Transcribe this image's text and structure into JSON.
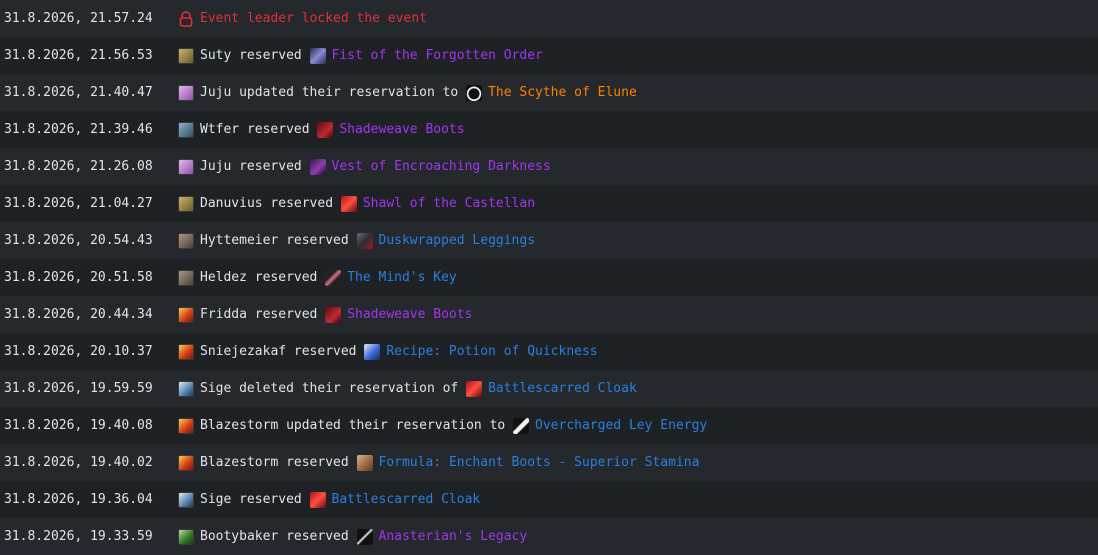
{
  "events": [
    {
      "time": "31.8.2026, 21.57.24",
      "type": "lock",
      "message": "Event leader locked the event",
      "icon": "lock-icon",
      "color": "#e0313b"
    },
    {
      "time": "31.8.2026, 21.56.53",
      "user": "Suty",
      "user_icon": "class-icon-rogue",
      "action": "reserved",
      "item": "Fist of the Forgotten Order",
      "item_icon": "weapon-icon",
      "quality": "epic"
    },
    {
      "time": "31.8.2026, 21.40.47",
      "user": "Juju",
      "user_icon": "class-icon-druid",
      "action": "updated their reservation to",
      "item": "The Scythe of Elune",
      "item_icon": "scythe-icon",
      "quality": "legendary"
    },
    {
      "time": "31.8.2026, 21.39.46",
      "user": "Wtfer",
      "user_icon": "class-icon-shaman",
      "action": "reserved",
      "item": "Shadeweave Boots",
      "item_icon": "boots-icon",
      "quality": "epic"
    },
    {
      "time": "31.8.2026, 21.26.08",
      "user": "Juju",
      "user_icon": "class-icon-druid",
      "action": "reserved",
      "item": "Vest of Encroaching Darkness",
      "item_icon": "vest-icon",
      "quality": "epic"
    },
    {
      "time": "31.8.2026, 21.04.27",
      "user": "Danuvius",
      "user_icon": "class-icon-rogue",
      "action": "reserved",
      "item": "Shawl of the Castellan",
      "item_icon": "cloak-icon",
      "quality": "epic"
    },
    {
      "time": "31.8.2026, 20.54.43",
      "user": "Hyttemeier",
      "user_icon": "class-icon-warrior",
      "action": "reserved",
      "item": "Duskwrapped Leggings",
      "item_icon": "leggings-icon",
      "quality": "rare"
    },
    {
      "time": "31.8.2026, 20.51.58",
      "user": "Heldez",
      "user_icon": "class-icon-warrior",
      "action": "reserved",
      "item": "The Mind's Key",
      "item_icon": "key-icon",
      "quality": "rare"
    },
    {
      "time": "31.8.2026, 20.44.34",
      "user": "Fridda",
      "user_icon": "class-icon-mage",
      "action": "reserved",
      "item": "Shadeweave Boots",
      "item_icon": "boots-icon",
      "quality": "epic"
    },
    {
      "time": "31.8.2026, 20.10.37",
      "user": "Sniejezakaf",
      "user_icon": "class-icon-mage",
      "action": "reserved",
      "item": "Recipe: Potion of Quickness",
      "item_icon": "recipe-icon",
      "quality": "rare"
    },
    {
      "time": "31.8.2026, 19.59.59",
      "user": "Sige",
      "user_icon": "class-icon-paladin",
      "action": "deleted their reservation of",
      "item": "Battlescarred Cloak",
      "item_icon": "cloak-icon",
      "quality": "rare"
    },
    {
      "time": "31.8.2026, 19.40.08",
      "user": "Blazestorm",
      "user_icon": "class-icon-mage",
      "action": "updated their reservation to",
      "item": "Overcharged Ley Energy",
      "item_icon": "energy-icon",
      "quality": "rare"
    },
    {
      "time": "31.8.2026, 19.40.02",
      "user": "Blazestorm",
      "user_icon": "class-icon-mage",
      "action": "reserved",
      "item": "Formula: Enchant Boots - Superior Stamina",
      "item_icon": "formula-icon",
      "quality": "rare"
    },
    {
      "time": "31.8.2026, 19.36.04",
      "user": "Sige",
      "user_icon": "class-icon-paladin",
      "action": "reserved",
      "item": "Battlescarred Cloak",
      "item_icon": "cloak-icon",
      "quality": "rare"
    },
    {
      "time": "31.8.2026, 19.33.59",
      "user": "Bootybaker",
      "user_icon": "class-icon-hunter",
      "action": "reserved",
      "item": "Anasterian's Legacy",
      "item_icon": "sword-icon",
      "quality": "epic"
    }
  ],
  "quality_colors": {
    "epic": "#a335ee",
    "rare": "#2a7fe0",
    "legendary": "#ff8000"
  }
}
